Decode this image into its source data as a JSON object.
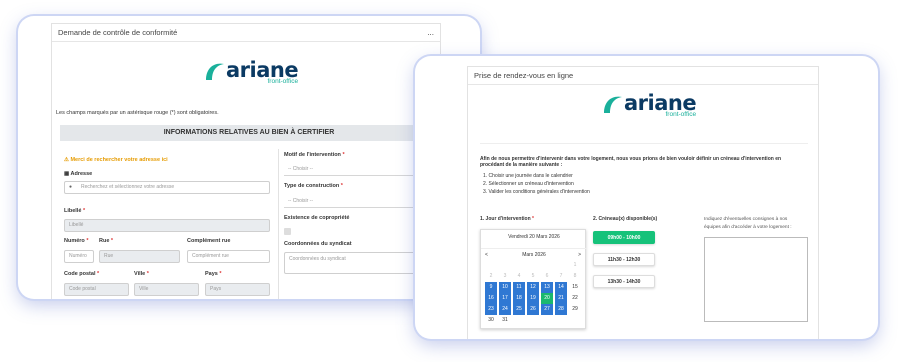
{
  "form1": {
    "title": "Demande de contrôle de conformité",
    "menu_dots": "...",
    "logo_word": "ariane",
    "logo_sub": "front-office",
    "required_note": "Les champs marqués par un astérisque rouge (*) sont obligatoires.",
    "section_title": "INFORMATIONS RELATIVES AU BIEN À CERTIFIER",
    "warning": "Merci de rechercher votre adresse ici",
    "address_label": "Adresse",
    "address_placeholder": "Recherchez et sélectionnez votre adresse",
    "libelle_label": "Libellé",
    "libelle_placeholder": "Libellé",
    "numero_label": "Numéro",
    "numero_placeholder": "Numéro",
    "rue_label": "Rue",
    "rue_placeholder": "Rue",
    "complement_label": "Complément rue",
    "complement_placeholder": "Complément rue",
    "cp_label": "Code postal",
    "cp_placeholder": "Code postal",
    "ville_label": "Ville",
    "ville_placeholder": "Ville",
    "pays_label": "Pays",
    "pays_placeholder": "Pays",
    "motif_label": "Motif de l'intervention",
    "motif_value": "-- Choisir --",
    "construction_label": "Type de construction",
    "construction_value": "-- Choisir --",
    "copro_label": "Existence de copropriété",
    "syndicat_label": "Coordonnées du syndicat",
    "syndicat_placeholder": "Coordonnées du syndicat"
  },
  "form2": {
    "title": "Prise de rendez-vous en ligne",
    "logo_word": "ariane",
    "logo_sub": "front-office",
    "intro_1": "Afin de nous permettre d'intervenir dans votre logement, nous vous prions de bien vouloir définir un créneau d'intervention en",
    "intro_2": "procédant de la manière suivante :",
    "step1": "1. Choisir une journée dans le calendrier",
    "step2": "2. Sélectionner un créneau d'intervention",
    "step3": "3. Valider les conditions générales d'intervention",
    "day_label": "1. Jour d'intervention",
    "slots_label": "2. Créneau(x) disponible(s)",
    "notes_label_1": "Indiquez d'éventuelles consignes à nos",
    "notes_label_2": "équipes afin d'accéder à votre logement :",
    "calendar": {
      "selected_date": "Vendredi 20 Mars 2026",
      "prev": "<",
      "next": ">",
      "month": "Mars 2026",
      "weeks": [
        [
          "",
          "",
          "",
          "",
          "",
          "",
          "1"
        ],
        [
          "2",
          "3",
          "4",
          "5",
          "6",
          "7",
          "8"
        ],
        [
          "9",
          "10",
          "11",
          "12",
          "13",
          "14",
          "15"
        ],
        [
          "16",
          "17",
          "18",
          "19",
          "20",
          "21",
          "22"
        ],
        [
          "23",
          "24",
          "25",
          "26",
          "27",
          "28",
          "29"
        ],
        [
          "30",
          "31",
          "",
          "",
          "",
          "",
          ""
        ]
      ]
    },
    "slots": [
      "09h00 - 10h00",
      "11h30 - 12h30",
      "13h30 - 14h30"
    ]
  },
  "colors": {
    "accent_blue": "#2f78d3",
    "accent_green": "#16c27a",
    "logo_navy": "#0b3a63",
    "logo_teal": "#1ab09b",
    "warning": "#e69b00"
  }
}
